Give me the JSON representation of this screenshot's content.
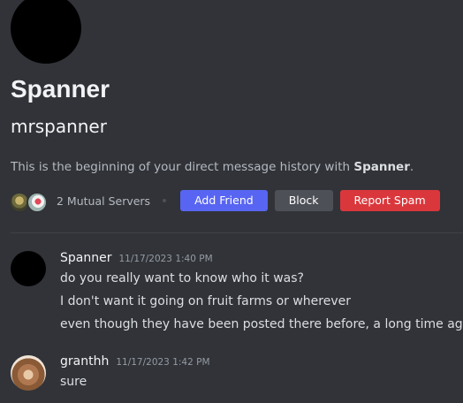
{
  "profile": {
    "display_name": "Spanner",
    "username": "mrspanner",
    "intro_prefix": "This is the beginning of your direct message history with ",
    "intro_name": "Spanner",
    "intro_suffix": "."
  },
  "mutual": {
    "count_label": "2 Mutual Servers"
  },
  "actions": {
    "add_friend": "Add Friend",
    "block": "Block",
    "report_spam": "Report Spam"
  },
  "colors": {
    "background": "#313338",
    "add_friend": "#5865f2",
    "block": "#4e5058",
    "report_spam": "#da373c"
  },
  "messages": [
    {
      "author": "Spanner",
      "timestamp": "11/17/2023 1:40 PM",
      "lines": [
        "do you really want to know who it was?",
        "I don't want it going on fruit farms or wherever",
        "even though they have been posted there before, a long time ago"
      ]
    },
    {
      "author": "granthh",
      "timestamp": "11/17/2023 1:42 PM",
      "lines": [
        "sure"
      ]
    }
  ]
}
